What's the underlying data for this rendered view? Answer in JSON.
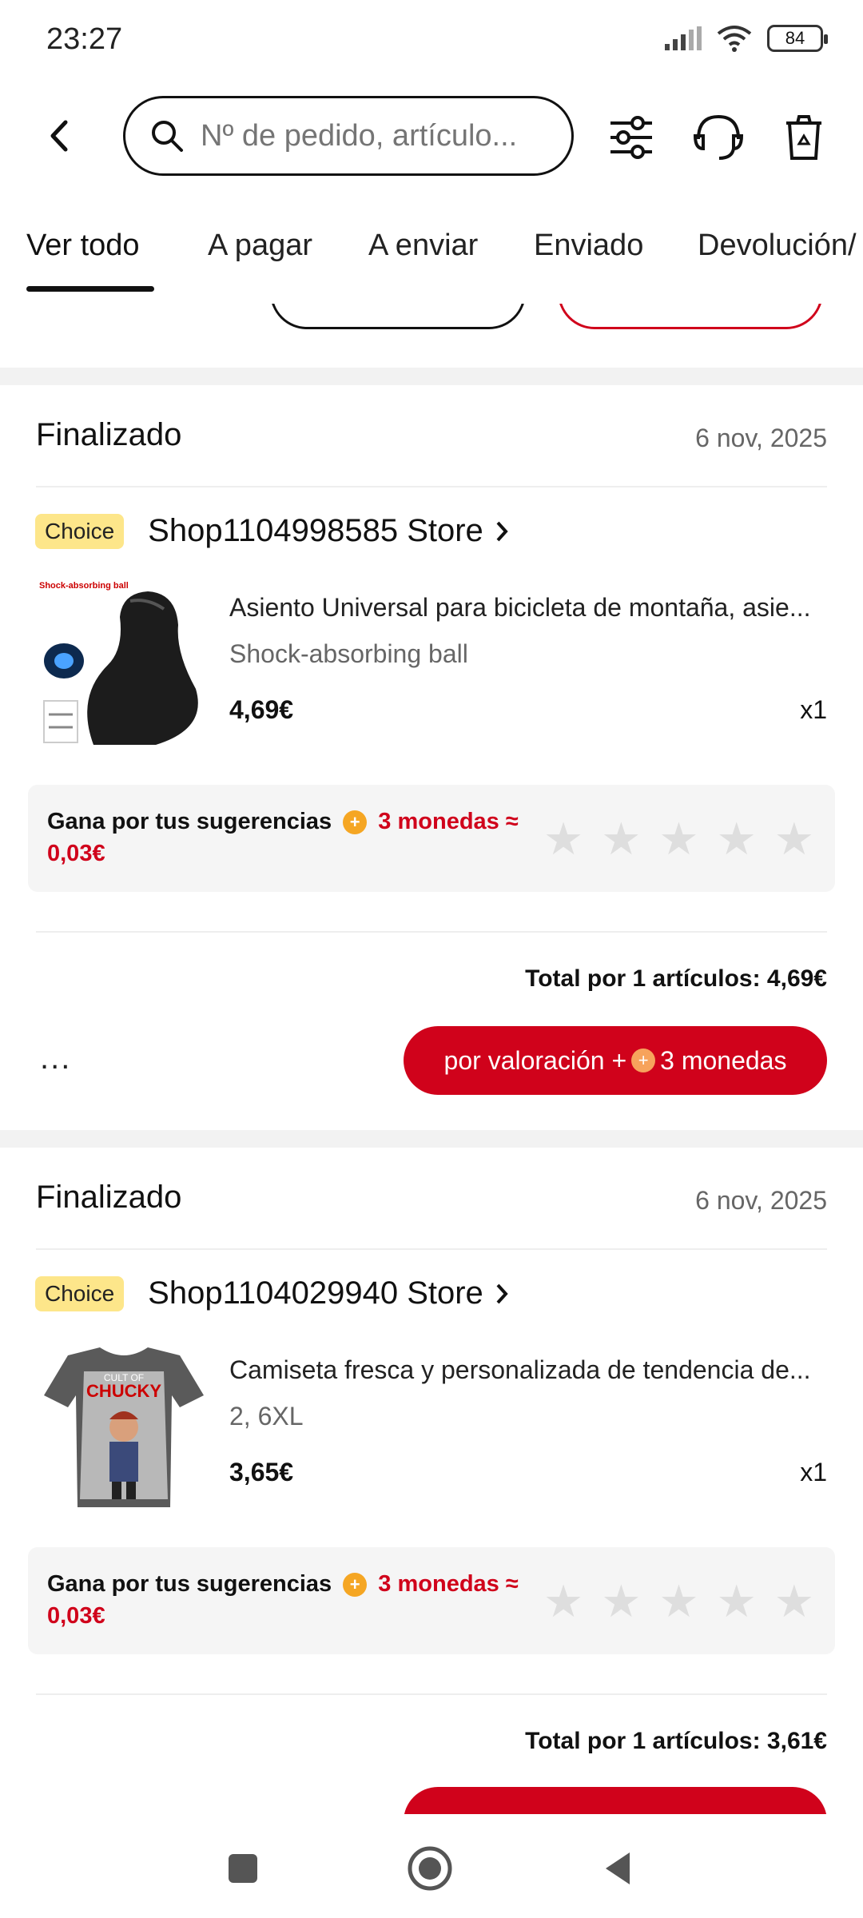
{
  "status_bar": {
    "time": "23:27",
    "battery": "84"
  },
  "header": {
    "search_placeholder": "Nº de pedido, artículo..."
  },
  "tabs": [
    {
      "label": "Ver todo"
    },
    {
      "label": "A pagar"
    },
    {
      "label": "A enviar"
    },
    {
      "label": "Enviado"
    },
    {
      "label": "Devolución/"
    }
  ],
  "orders": [
    {
      "status": "Finalizado",
      "date": "6 nov, 2025",
      "badge": "Choice",
      "store": "Shop1104998585 Store",
      "product_title": "Asiento Universal para bicicleta de montaña, asie...",
      "variant": "Shock-absorbing ball",
      "image_caption": "Shock-absorbing ball",
      "price": "4,69€",
      "qty": "x1",
      "reward_text": "Gana por tus sugerencias",
      "reward_coins": "3 monedas ≈",
      "reward_value": "0,03€",
      "total": "Total por 1 artículos: 4,69€",
      "more": "...",
      "rate_label": "por valoración +",
      "rate_coins": "3 monedas"
    },
    {
      "status": "Finalizado",
      "date": "6 nov, 2025",
      "badge": "Choice",
      "store": "Shop1104029940 Store",
      "product_title": "Camiseta fresca y personalizada de tendencia de...",
      "variant": "2, 6XL",
      "image_caption_top": "CULT OF",
      "image_caption_main": "CHUCKY",
      "price": "3,65€",
      "qty": "x1",
      "reward_text": "Gana por tus sugerencias",
      "reward_coins": "3 monedas ≈",
      "reward_value": "0,03€",
      "total": "Total por 1 artículos: 3,61€"
    }
  ],
  "colors": {
    "accent": "#d0021b",
    "badge": "#fde68a",
    "coin": "#f5a623"
  },
  "icons": [
    "back-arrow-icon",
    "search-icon",
    "filter-icon",
    "headset-icon",
    "trash-icon",
    "chevron-right-icon",
    "coin-icon",
    "star-icon",
    "nav-square-icon",
    "nav-home-icon",
    "nav-back-icon"
  ]
}
